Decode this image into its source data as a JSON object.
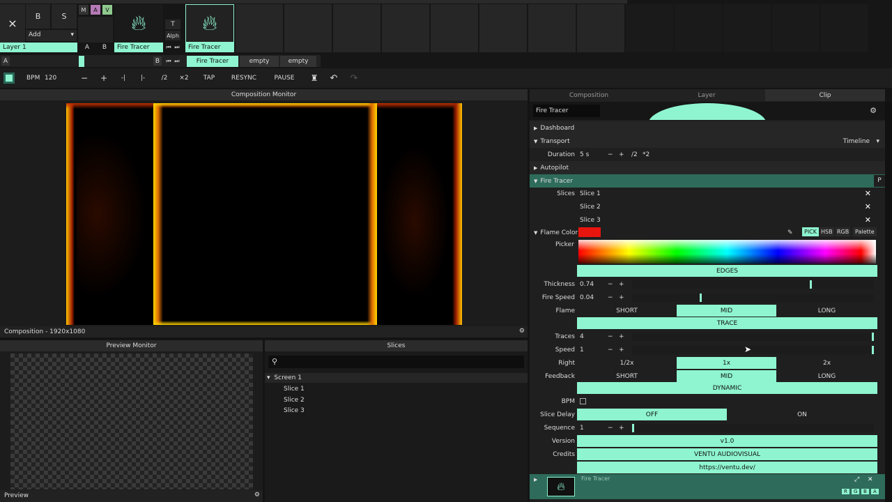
{
  "top": {
    "layer_label": "Layer 1",
    "btn_b": "B",
    "btn_s": "S",
    "btn_m": "M",
    "btn_a": "A",
    "btn_v": "V",
    "add_label": "Add",
    "ab_a": "A",
    "ab_b": "B",
    "clip_name": "Fire Tracer",
    "t_label": "T",
    "alph_label": "Alph",
    "deck_a": "A",
    "deck_b": "B",
    "col_labels": [
      "Fire Tracer",
      "empty",
      "empty"
    ]
  },
  "toolbar": {
    "bpm_label": "BPM",
    "bpm_value": "120",
    "buttons": [
      "−",
      "+",
      "-|",
      "|-",
      "/2",
      "×2",
      "TAP",
      "RESYNC",
      "PAUSE"
    ]
  },
  "comp_monitor": {
    "title": "Composition Monitor",
    "footer": "Composition - 1920x1080"
  },
  "preview": {
    "title": "Preview Monitor",
    "footer": "Preview"
  },
  "slices_panel": {
    "title": "Slices",
    "screen": "Screen 1",
    "items": [
      "Slice 1",
      "Slice 2",
      "Slice 3"
    ]
  },
  "tabs": [
    "Composition",
    "Layer",
    "Clip"
  ],
  "clip": {
    "name": "Fire Tracer",
    "dashboard": "Dashboard",
    "transport": "Transport",
    "timeline": "Timeline",
    "duration_label": "Duration",
    "duration_value": "5 s",
    "duration_buttons": [
      "−",
      "+",
      "/2",
      "*2"
    ],
    "autopilot": "Autopilot",
    "effect_header": "Fire Tracer",
    "effect_p": "P",
    "slices_label": "Slices",
    "slices": [
      "Slice 1",
      "Slice 2",
      "Slice 3"
    ],
    "flame_color_label": "Flame Color",
    "flame_color": "#e8140e",
    "color_modes": [
      "PICK",
      "HSB",
      "RGB",
      "Palette"
    ],
    "picker_label": "Picker",
    "edges": "EDGES",
    "thickness_label": "Thickness",
    "thickness_value": "0.74",
    "firespeed_label": "Fire Speed",
    "firespeed_value": "0.04",
    "flame_label": "Flame",
    "flame_opts": [
      "SHORT",
      "MID",
      "LONG"
    ],
    "trace": "TRACE",
    "traces_label": "Traces",
    "traces_value": "4",
    "speed_label": "Speed",
    "speed_value": "1",
    "right_label": "Right",
    "right_opts": [
      "1/2x",
      "1x",
      "2x"
    ],
    "feedback_label": "Feedback",
    "feedback_opts": [
      "SHORT",
      "MID",
      "LONG"
    ],
    "dynamic": "DYNAMIC",
    "bpm_label": "BPM",
    "slice_delay_label": "Slice Delay",
    "slice_delay_opts": [
      "OFF",
      "ON"
    ],
    "sequence_label": "Sequence",
    "sequence_value": "1",
    "version_label": "Version",
    "version_value": "v1.0",
    "credits_label": "Credits",
    "credits_value": "VENTU AUDIOVISUAL",
    "credits_url": "https://ventu.dev/",
    "bottom_name": "Fire Tracer",
    "rgba": [
      "R",
      "G",
      "B",
      "A"
    ]
  }
}
